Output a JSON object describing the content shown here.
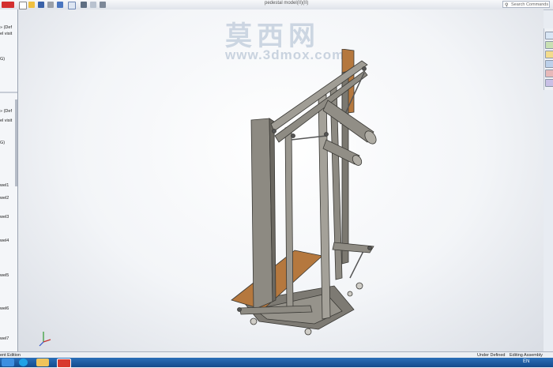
{
  "window": {
    "title": "pedestal model(II)(II)",
    "search_placeholder": "Search Commands"
  },
  "watermark": {
    "chinese": "莫西网",
    "url": "www.3dmox.com"
  },
  "left_panel": {
    "items": [
      {
        "label": "» (Def"
      },
      {
        "label": "el visit"
      },
      {
        "label": "G)"
      },
      {
        "label": "» (Def"
      },
      {
        "label": "el visit"
      },
      {
        "label": "G)"
      },
      {
        "label": "wel1"
      },
      {
        "label": "wel2"
      },
      {
        "label": "wel3"
      },
      {
        "label": "wel4"
      },
      {
        "label": "wel5"
      },
      {
        "label": "wel6"
      },
      {
        "label": "wel7"
      }
    ]
  },
  "status_bar": {
    "edition": "ent Edition",
    "definition": "Under Defined",
    "mode": "Editing Assembly"
  },
  "taskbar": {
    "language": "EN"
  },
  "colors": {
    "taskbar": "#1d5aa0",
    "viewport_bg": "#ffffff",
    "frame_steel": "#8a8780",
    "wood": "#b5783e"
  },
  "icons": {
    "search": "search-icon",
    "axis": "axis-triad-icon"
  }
}
